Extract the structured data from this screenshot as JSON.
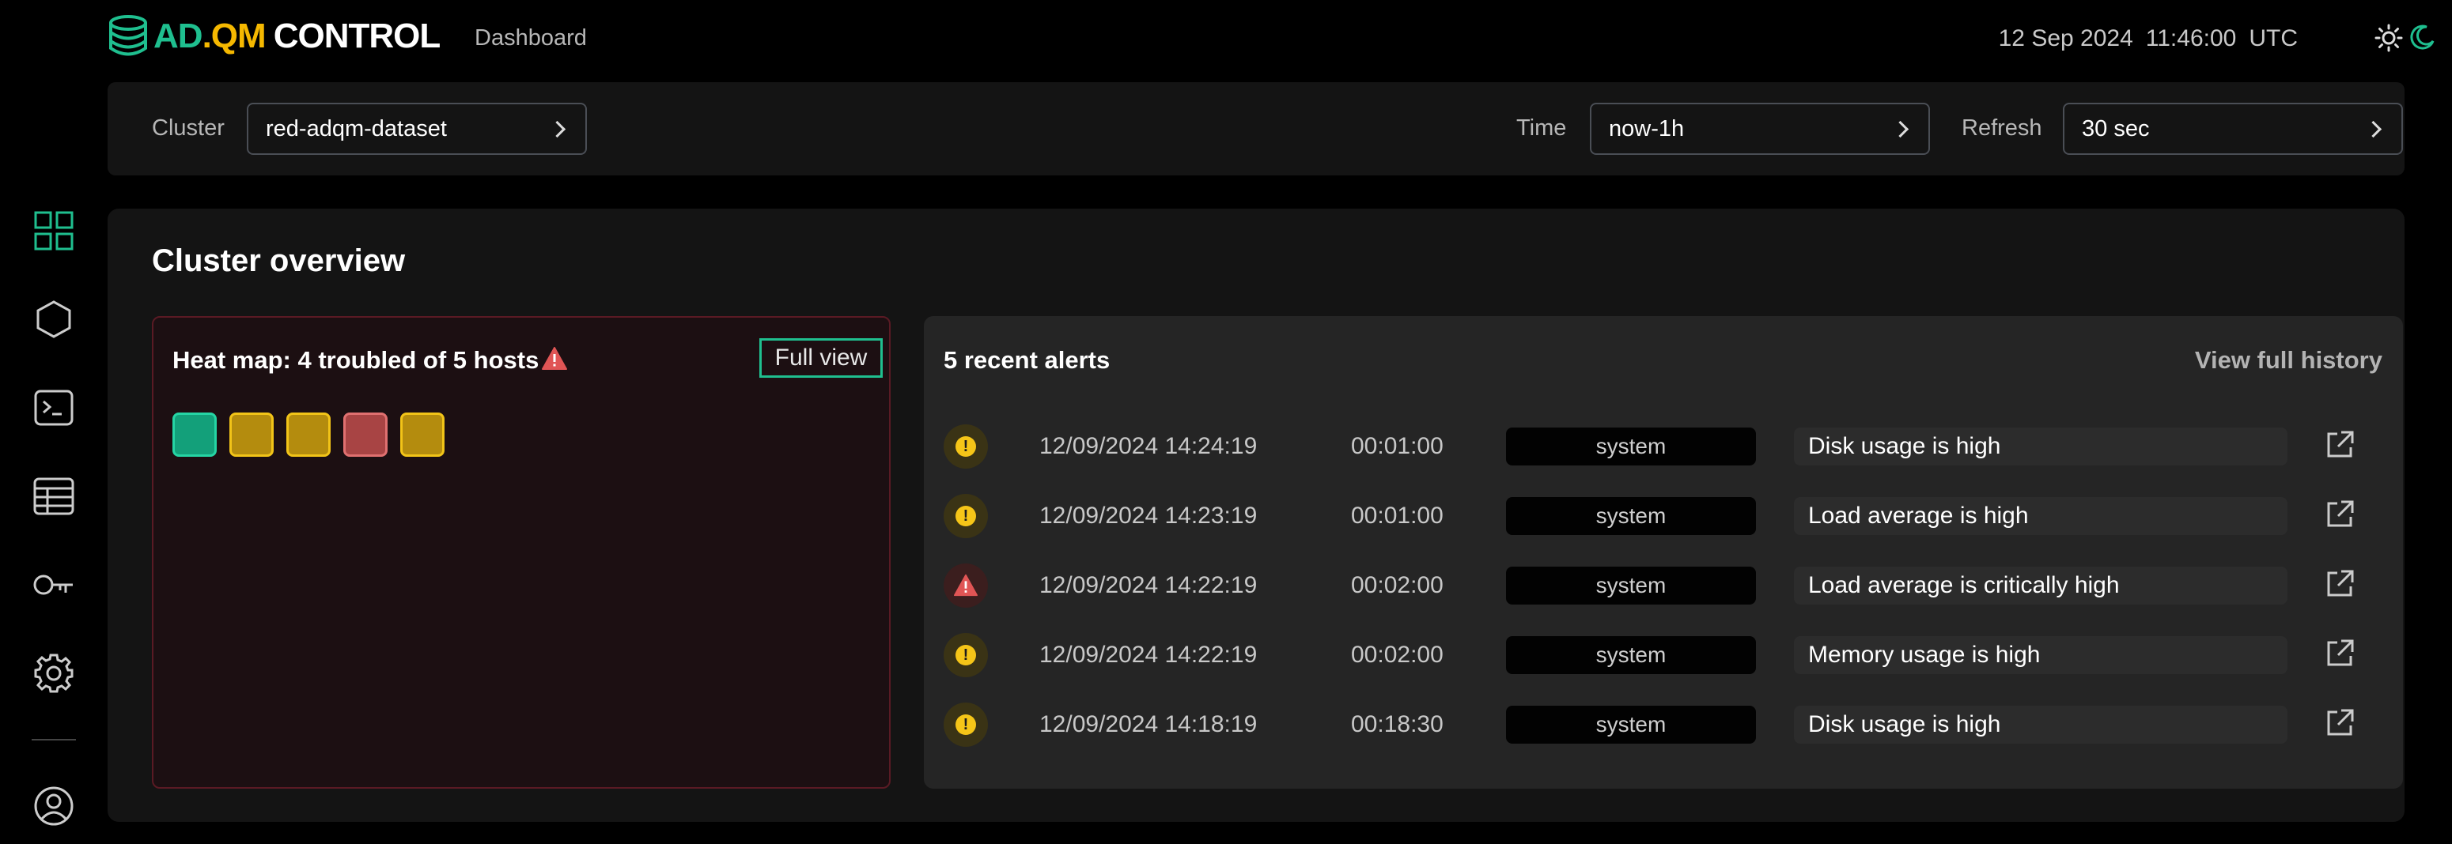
{
  "header": {
    "logo_part1": "AD",
    "logo_dot": ".",
    "logo_part2": "QM",
    "logo_part3": "CONTROL",
    "nav_label": "Dashboard",
    "date": "12 Sep 2024",
    "time": "11:46:00",
    "timezone": "UTC"
  },
  "filters": {
    "cluster_label": "Cluster",
    "cluster_value": "red-adqm-dataset",
    "time_label": "Time",
    "time_value": "now-1h",
    "refresh_label": "Refresh",
    "refresh_value": "30 sec"
  },
  "sidebar": {
    "icons": [
      "dashboard-grid-icon",
      "hexagon-icon",
      "terminal-icon",
      "table-icon",
      "key-icon",
      "gear-icon",
      "user-icon"
    ]
  },
  "overview": {
    "title": "Cluster overview",
    "heatmap": {
      "title": "Heat map: 4 troubled of 5 hosts",
      "full_view_label": "Full view",
      "hosts": [
        {
          "status": "ok",
          "color": "#13a07a",
          "border": "#25d5a4"
        },
        {
          "status": "warning",
          "color": "#b48c0e",
          "border": "#f2c418"
        },
        {
          "status": "warning",
          "color": "#b48c0e",
          "border": "#f2c418"
        },
        {
          "status": "critical",
          "color": "#a84444",
          "border": "#e07070"
        },
        {
          "status": "warning",
          "color": "#b48c0e",
          "border": "#f2c418"
        }
      ]
    },
    "alerts": {
      "title": "5 recent alerts",
      "history_label": "View full history",
      "rows": [
        {
          "severity": "warning",
          "timestamp": "12/09/2024 14:24:19",
          "duration": "00:01:00",
          "source": "system",
          "message": "Disk usage is high"
        },
        {
          "severity": "warning",
          "timestamp": "12/09/2024 14:23:19",
          "duration": "00:01:00",
          "source": "system",
          "message": "Load average is high"
        },
        {
          "severity": "critical",
          "timestamp": "12/09/2024 14:22:19",
          "duration": "00:02:00",
          "source": "system",
          "message": "Load average is critically high"
        },
        {
          "severity": "warning",
          "timestamp": "12/09/2024 14:22:19",
          "duration": "00:02:00",
          "source": "system",
          "message": "Memory usage is high"
        },
        {
          "severity": "warning",
          "timestamp": "12/09/2024 14:18:19",
          "duration": "00:18:30",
          "source": "system",
          "message": "Disk usage is high"
        }
      ]
    }
  },
  "colors": {
    "accent": "#1fbf8f",
    "warning": "#f5c518",
    "critical": "#e05555"
  }
}
